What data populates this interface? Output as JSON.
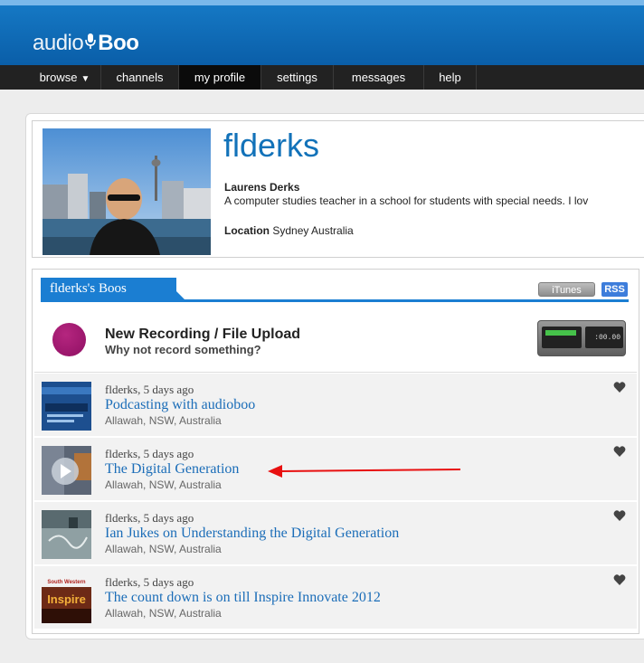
{
  "app": {
    "logo_light": "audio",
    "logo_bold": "Boo"
  },
  "nav": {
    "items": [
      {
        "label": "browse",
        "caret": "▼"
      },
      {
        "label": "channels"
      },
      {
        "label": "my profile"
      },
      {
        "label": "settings"
      },
      {
        "label": "messages"
      },
      {
        "label": "help"
      }
    ]
  },
  "profile": {
    "username": "flderks",
    "real_name": "Laurens Derks",
    "bio": "A computer studies teacher in a school for students with special needs. I lov",
    "location_label": "Location",
    "location": "Sydney Australia"
  },
  "boos": {
    "tab_label": "flderks's Boos",
    "itunes_label": "iTunes",
    "rss_label": "RSS",
    "new_recording_title": "New Recording / File Upload",
    "new_recording_sub": "Why not record something?",
    "device_time": ":00.00",
    "items": [
      {
        "meta": "flderks, 5 days ago",
        "title": "Podcasting with audioboo",
        "place": "Allawah, NSW, Australia",
        "thumb": "audioboo-screenshot"
      },
      {
        "meta": "flderks, 5 days ago",
        "title": "The Digital Generation",
        "place": "Allawah, NSW, Australia",
        "thumb": "video-play"
      },
      {
        "meta": "flderks, 5 days ago",
        "title": "Ian Jukes on Understanding the Digital Generation",
        "place": "Allawah, NSW, Australia",
        "thumb": "sketch"
      },
      {
        "meta": "flderks, 5 days ago",
        "title": "The count down is on till Inspire Innovate 2012",
        "place": "Allawah, NSW, Australia",
        "thumb": "inspire-logo",
        "thumb_text_top": "South Western",
        "thumb_text_main": "Inspire"
      }
    ]
  },
  "colors": {
    "brand_blue": "#1272b9",
    "link_blue": "#1b6db8",
    "record_magenta": "#a01a72",
    "annotation_red": "#e81010"
  }
}
